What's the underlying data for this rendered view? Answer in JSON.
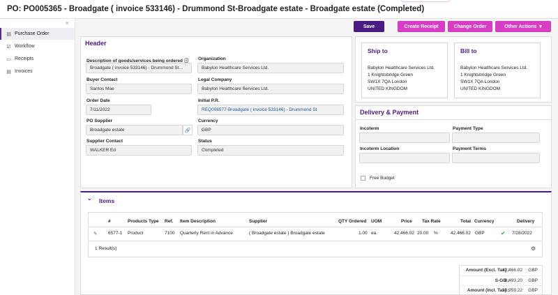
{
  "page": {
    "title": "PO: PO005365 - Broadgate ( invoice 533146) - Drummond St-Broadgate estate - Broadgate estate (Completed)"
  },
  "sidebar": {
    "collapse_icon": "«",
    "items": [
      {
        "label": "Purchase Order",
        "icon": "document-icon",
        "glyph": "▤",
        "active": true
      },
      {
        "label": "Workflow",
        "icon": "checkbox-icon",
        "glyph": "☑",
        "active": false
      },
      {
        "label": "Receipts",
        "icon": "receipt-icon",
        "glyph": "▭",
        "active": false
      },
      {
        "label": "Invoices",
        "icon": "invoice-icon",
        "glyph": "▤",
        "active": false
      }
    ]
  },
  "toolbar": {
    "save": "Save",
    "create_receipt": "Create Receipt",
    "change_order": "Change Order",
    "other_actions": "Other Actions",
    "dropdown_glyph": "▾"
  },
  "header": {
    "title": "Header",
    "description_label": "Description of goods/services being ordered",
    "description_info_glyph": "ⓘ",
    "description_value": "Broadgate ( invoice 533146) - Drummond St...",
    "organization_label": "Organization",
    "organization_value": "Babylon Healthcare Services Ltd.",
    "buyer_label": "Buyer Contact",
    "buyer_value": "Santos Mae",
    "legal_label": "Legal Company",
    "legal_value": "Babylon Healthcare Services Ltd.",
    "order_date_label": "Order Date",
    "order_date_value": "7/11/2022",
    "initial_pr_label": "Initial P.R.",
    "initial_pr_value": "REQ006577-Broadgate ( invoice 533146) - Drummond St",
    "supplier_label": "PO Supplier",
    "supplier_value": "Broadgate estate",
    "supplier_link_glyph": "🔗",
    "currency_label": "Currency",
    "currency_value": "GBP",
    "supplier_contact_label": "Supplier Contact",
    "supplier_contact_value": "WALKER Ed",
    "status_label": "Status",
    "status_value": "Completed"
  },
  "ship_to": {
    "title": "Ship to",
    "lines": [
      "Babylon Healthcare Services Ltd.",
      "1 Knightsbridge Green",
      "SW1X 7QA London",
      "UNITED KINGDOM"
    ]
  },
  "bill_to": {
    "title": "Bill to",
    "lines": [
      "Babylon Healthcare Services Ltd.",
      "1 Knightsbridge Green",
      "SW1X 7QA London",
      "UNITED KINGDOM"
    ]
  },
  "delivery": {
    "title": "Delivery & Payment",
    "incoterm_label": "Incoterm",
    "payment_type_label": "Payment Type",
    "incoterm_location_label": "Incoterm Location",
    "payment_terms_label": "Payment Terms",
    "free_budget_label": "Free Budget"
  },
  "items": {
    "title": "Items",
    "toggle_glyph": "⌄",
    "columns": {
      "num": "#",
      "product_type": "Products Type",
      "ref": "Ref.",
      "description": "Item Description",
      "supplier": "Supplier",
      "qty": "QTY Ordered",
      "uom": "UOM",
      "price": "Price",
      "tax_rate": "Tax Rate",
      "total": "Total",
      "currency": "Currency",
      "delivery": "Delivery"
    },
    "rows": [
      {
        "edit_glyph": "✎",
        "num": "6577-1",
        "product_type": "Product",
        "ref": "7100",
        "description": "Quarterly Rent in Advance",
        "supplier": "( Broadgate estate ) Broadgate estate",
        "qty": "1.00",
        "uom": "ea.",
        "price": "42,466.02",
        "tax_rate": "20.00",
        "tax_unit": "%",
        "total": "42,466.02",
        "currency": "GBP",
        "check_glyph": "✔",
        "delivery": "7/28/2022"
      }
    ],
    "results": "1 Result(s)",
    "settings_glyph": "⚙"
  },
  "totals": [
    {
      "label": "Amount (Excl. Tax) :",
      "value": "42,466.02",
      "currency": "GBP"
    },
    {
      "label": "S-GB :",
      "value": "8,493.20",
      "currency": "GBP"
    },
    {
      "label": "Amount (Incl. Tax) :",
      "value": "50,959.22",
      "currency": "GBP"
    }
  ],
  "colors": {
    "brand_purple": "#4a1a85",
    "action_pink": "#d63cc4",
    "link_blue": "#1b5aa8",
    "check_green": "#2e9e3e"
  }
}
